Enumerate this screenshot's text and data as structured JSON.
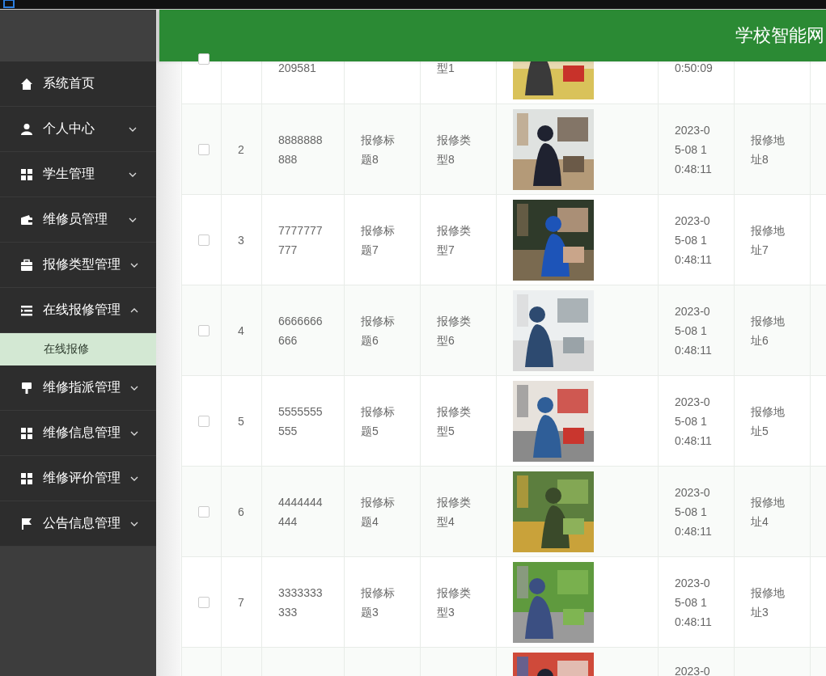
{
  "header": {
    "title": "学校智能网"
  },
  "sidebar": {
    "items": [
      {
        "label": "系统首页"
      },
      {
        "label": "个人中心",
        "expanded": false
      },
      {
        "label": "学生管理",
        "expanded": false
      },
      {
        "label": "维修员管理",
        "expanded": false
      },
      {
        "label": "报修类型管理",
        "expanded": false
      },
      {
        "label": "在线报修管理",
        "expanded": true,
        "children": [
          {
            "label": "在线报修",
            "selected": true
          }
        ]
      },
      {
        "label": "维修指派管理",
        "expanded": false
      },
      {
        "label": "维修信息管理",
        "expanded": false
      },
      {
        "label": "维修评价管理",
        "expanded": false
      },
      {
        "label": "公告信息管理",
        "expanded": false
      }
    ]
  },
  "table": {
    "rows": [
      {
        "checked": false,
        "account": "209581",
        "type": "型1",
        "time": "0:50:09"
      },
      {
        "checked": false,
        "index": "2",
        "account": "8888888888",
        "title": "报修标题8",
        "type": "报修类型8",
        "time": "2023-05-08 10:48:11",
        "address": "报修地址8"
      },
      {
        "checked": false,
        "index": "3",
        "account": "7777777777",
        "title": "报修标题7",
        "type": "报修类型7",
        "time": "2023-05-08 10:48:11",
        "address": "报修地址7"
      },
      {
        "checked": false,
        "index": "4",
        "account": "6666666666",
        "title": "报修标题6",
        "type": "报修类型6",
        "time": "2023-05-08 10:48:11",
        "address": "报修地址6"
      },
      {
        "checked": false,
        "index": "5",
        "account": "5555555555",
        "title": "报修标题5",
        "type": "报修类型5",
        "time": "2023-05-08 10:48:11",
        "address": "报修地址5"
      },
      {
        "checked": false,
        "index": "6",
        "account": "4444444444",
        "title": "报修标题4",
        "type": "报修类型4",
        "time": "2023-05-08 10:48:11",
        "address": "报修地址4"
      },
      {
        "checked": false,
        "index": "7",
        "account": "3333333333",
        "title": "报修标题3",
        "type": "报修类型3",
        "time": "2023-05-08 10:48:11",
        "address": "报修地址3"
      },
      {
        "time": "2023-0"
      }
    ]
  }
}
